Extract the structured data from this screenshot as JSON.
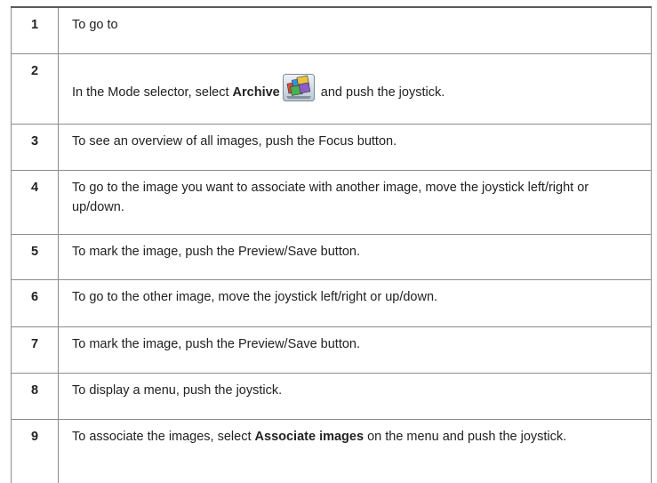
{
  "steps": [
    {
      "number": "1",
      "text": "To go to"
    },
    {
      "number": "2",
      "text_before": "In the Mode selector, select ",
      "bold": "Archive",
      "text_after": " and push the joystick.",
      "icon": "archive-mode-icon"
    },
    {
      "number": "3",
      "text": "To see an overview of all images, push the Focus button."
    },
    {
      "number": "4",
      "text": "To go to the image you want to associate with another image, move the joystick left/right or up/down."
    },
    {
      "number": "5",
      "text": "To mark the image, push the Preview/Save button."
    },
    {
      "number": "6",
      "text": "To go to the other image, move the joystick left/right or up/down."
    },
    {
      "number": "7",
      "text": "To mark the image, push the Preview/Save button."
    },
    {
      "number": "8",
      "text": "To display a menu, push the joystick."
    },
    {
      "number": "9",
      "text_before": "To associate the images, select ",
      "bold": "Associate images",
      "text_after": " on the menu and push the joystick."
    }
  ]
}
